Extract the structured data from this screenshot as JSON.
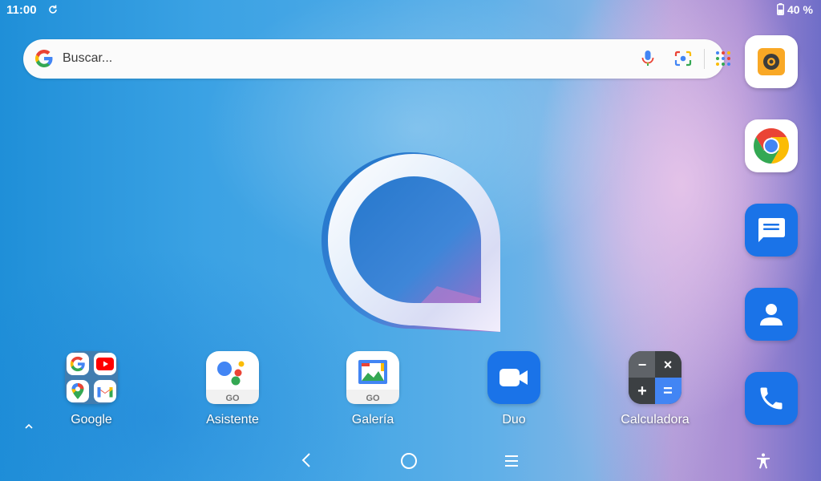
{
  "status_bar": {
    "time": "11:00",
    "battery": "40 %",
    "icons": [
      "sync-icon",
      "battery-icon"
    ]
  },
  "search": {
    "placeholder": "Buscar...",
    "icons": [
      "google-g-icon",
      "mic-icon",
      "lens-icon",
      "apps-grid-icon"
    ]
  },
  "home_apps": [
    {
      "label": "Google",
      "icon": "google-folder-icon"
    },
    {
      "label": "Asistente",
      "icon": "assistant-go-icon",
      "badge": "GO"
    },
    {
      "label": "Galería",
      "icon": "gallery-go-icon",
      "badge": "GO"
    },
    {
      "label": "Duo",
      "icon": "duo-icon"
    },
    {
      "label": "Calculadora",
      "icon": "calculator-icon"
    }
  ],
  "folder_apps": [
    "google-icon",
    "youtube-icon",
    "maps-icon",
    "gmail-icon"
  ],
  "dock_apps": [
    "camera-icon",
    "chrome-icon",
    "messages-icon",
    "contacts-icon",
    "phone-icon"
  ],
  "calculator_symbols": {
    "minus": "−",
    "times": "×",
    "plus": "+",
    "equals": "="
  },
  "nav": [
    "back-icon",
    "home-icon",
    "recents-icon",
    "accessibility-icon"
  ],
  "colors": {
    "google_blue": "#4285f4",
    "google_red": "#ea4335",
    "google_yellow": "#fbbc05",
    "google_green": "#34a853",
    "dock_blue": "#1a73e8",
    "camera_orange": "#f9a825"
  }
}
